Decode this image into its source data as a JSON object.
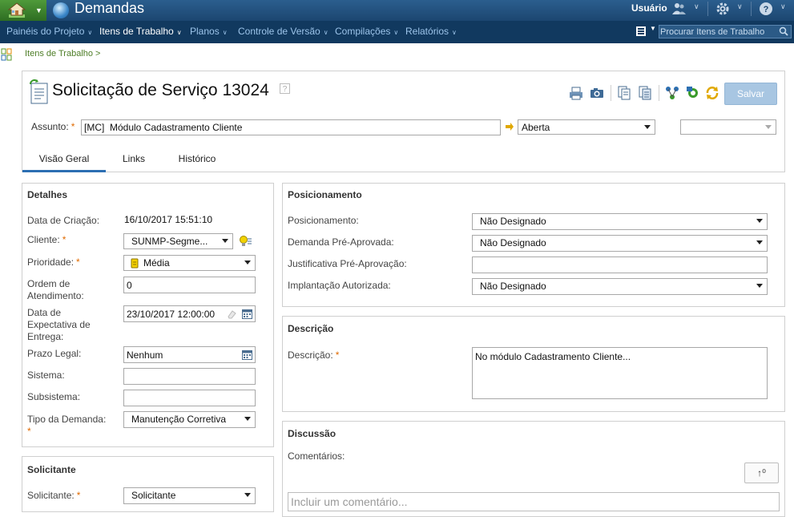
{
  "topbar": {
    "app_title": "Demandas",
    "user_label": "Usuário"
  },
  "nav": {
    "items": [
      {
        "label": "Painéis do Projeto"
      },
      {
        "label": "Itens de Trabalho"
      },
      {
        "label": "Planos"
      },
      {
        "label": "Controle de Versão"
      },
      {
        "label": "Compilações"
      },
      {
        "label": "Relatórios"
      }
    ],
    "search_placeholder": "Procurar Itens de Trabalho"
  },
  "breadcrumb": "Itens de Trabalho >",
  "header": {
    "title": "Solicitação de Serviço 13024",
    "help": "?",
    "save_label": "Salvar",
    "subject_label": "Assunto:",
    "required_mark": "*",
    "subject_value": "[MC]  Módulo Cadastramento Cliente",
    "state_value": "Aberta",
    "action_value": ""
  },
  "tabs": [
    {
      "label": "Visão Geral"
    },
    {
      "label": "Links"
    },
    {
      "label": "Histórico"
    }
  ],
  "details": {
    "title": "Detalhes",
    "creation_label": "Data de Criação:",
    "creation_value": "16/10/2017 15:51:10",
    "client_label": "Cliente:",
    "client_value": "SUNMP-Segme...",
    "priority_label": "Prioridade:",
    "priority_value": "Média",
    "order_label": "Ordem de Atendimento:",
    "order_value": "0",
    "expected_label": "Data de Expectativa de Entrega:",
    "expected_value": "23/10/2017 12:00:00",
    "legal_label": "Prazo Legal:",
    "legal_value": "Nenhum",
    "system_label": "Sistema:",
    "system_value": "",
    "subsystem_label": "Subsistema:",
    "subsystem_value": "",
    "type_label": "Tipo da Demanda:",
    "type_value": "Manutenção Corretiva"
  },
  "requester": {
    "title": "Solicitante",
    "label": "Solicitante:",
    "value": "Solicitante"
  },
  "positioning": {
    "title": "Posicionamento",
    "pos_label": "Posicionamento:",
    "pos_value": "Não Designado",
    "preapproved_label": "Demanda Pré-Aprovada:",
    "preapproved_value": "Não Designado",
    "justification_label": "Justificativa Pré-Aprovação:",
    "justification_value": "",
    "deployment_label": "Implantação Autorizada:",
    "deployment_value": "Não Designado"
  },
  "description": {
    "title": "Descrição",
    "label": "Descrição:",
    "value": "No módulo Cadastramento Cliente..."
  },
  "discussion": {
    "title": "Discussão",
    "comments_label": "Comentários:",
    "sort_label": "↑⁰",
    "comment_placeholder": "Incluir um comentário..."
  },
  "colors": {
    "topbar": "#1c4670",
    "navbar": "#11395f",
    "accent": "#2c6fb2",
    "required": "#e06a00",
    "save_button": "#a8c6e2"
  }
}
